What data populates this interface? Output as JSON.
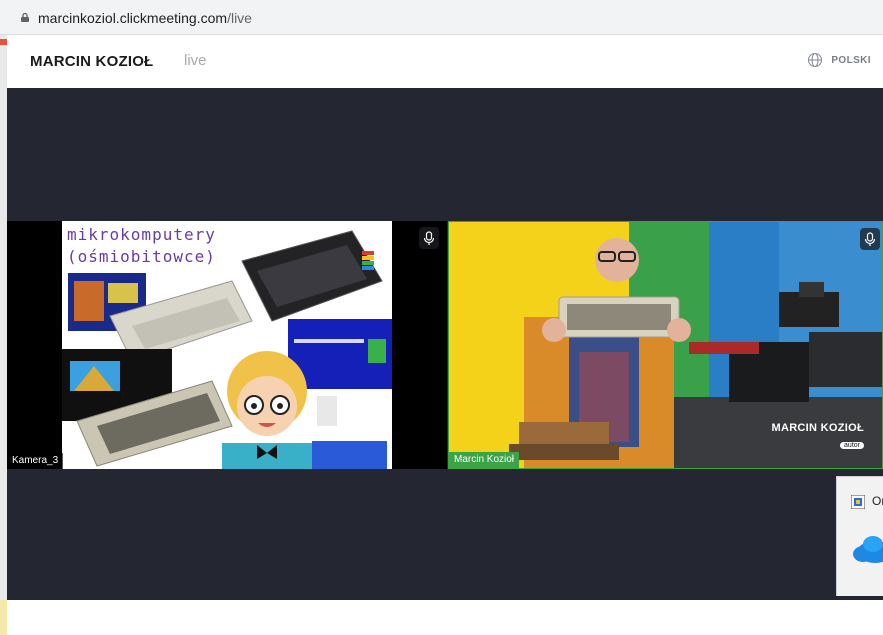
{
  "browser": {
    "url_host": "marcinkoziol.clickmeeting.com",
    "url_path": "/live"
  },
  "header": {
    "brand": "MARCIN KOZIOŁ",
    "status": "live",
    "language": "POLSKI",
    "language_icon": "globe-icon"
  },
  "tiles": [
    {
      "label": "Kamera_3",
      "slide_title_line1": "mikrokomputery",
      "slide_title_line2": "(ośmiobitowce)",
      "mic_icon": "microphone-icon"
    },
    {
      "label": "Marcin Kozioł",
      "overlay_name": "MARCIN KOZIOŁ",
      "overlay_role": "autor",
      "mic_icon": "microphone-icon"
    }
  ],
  "notification": {
    "text": "Or",
    "app_icon": "onedrive-icon"
  },
  "colors": {
    "stage_bg": "#242631",
    "speaker_border": "#38a83a",
    "name_tag_active": "#3aa447",
    "yellow_backdrop": "#f4d21a"
  }
}
